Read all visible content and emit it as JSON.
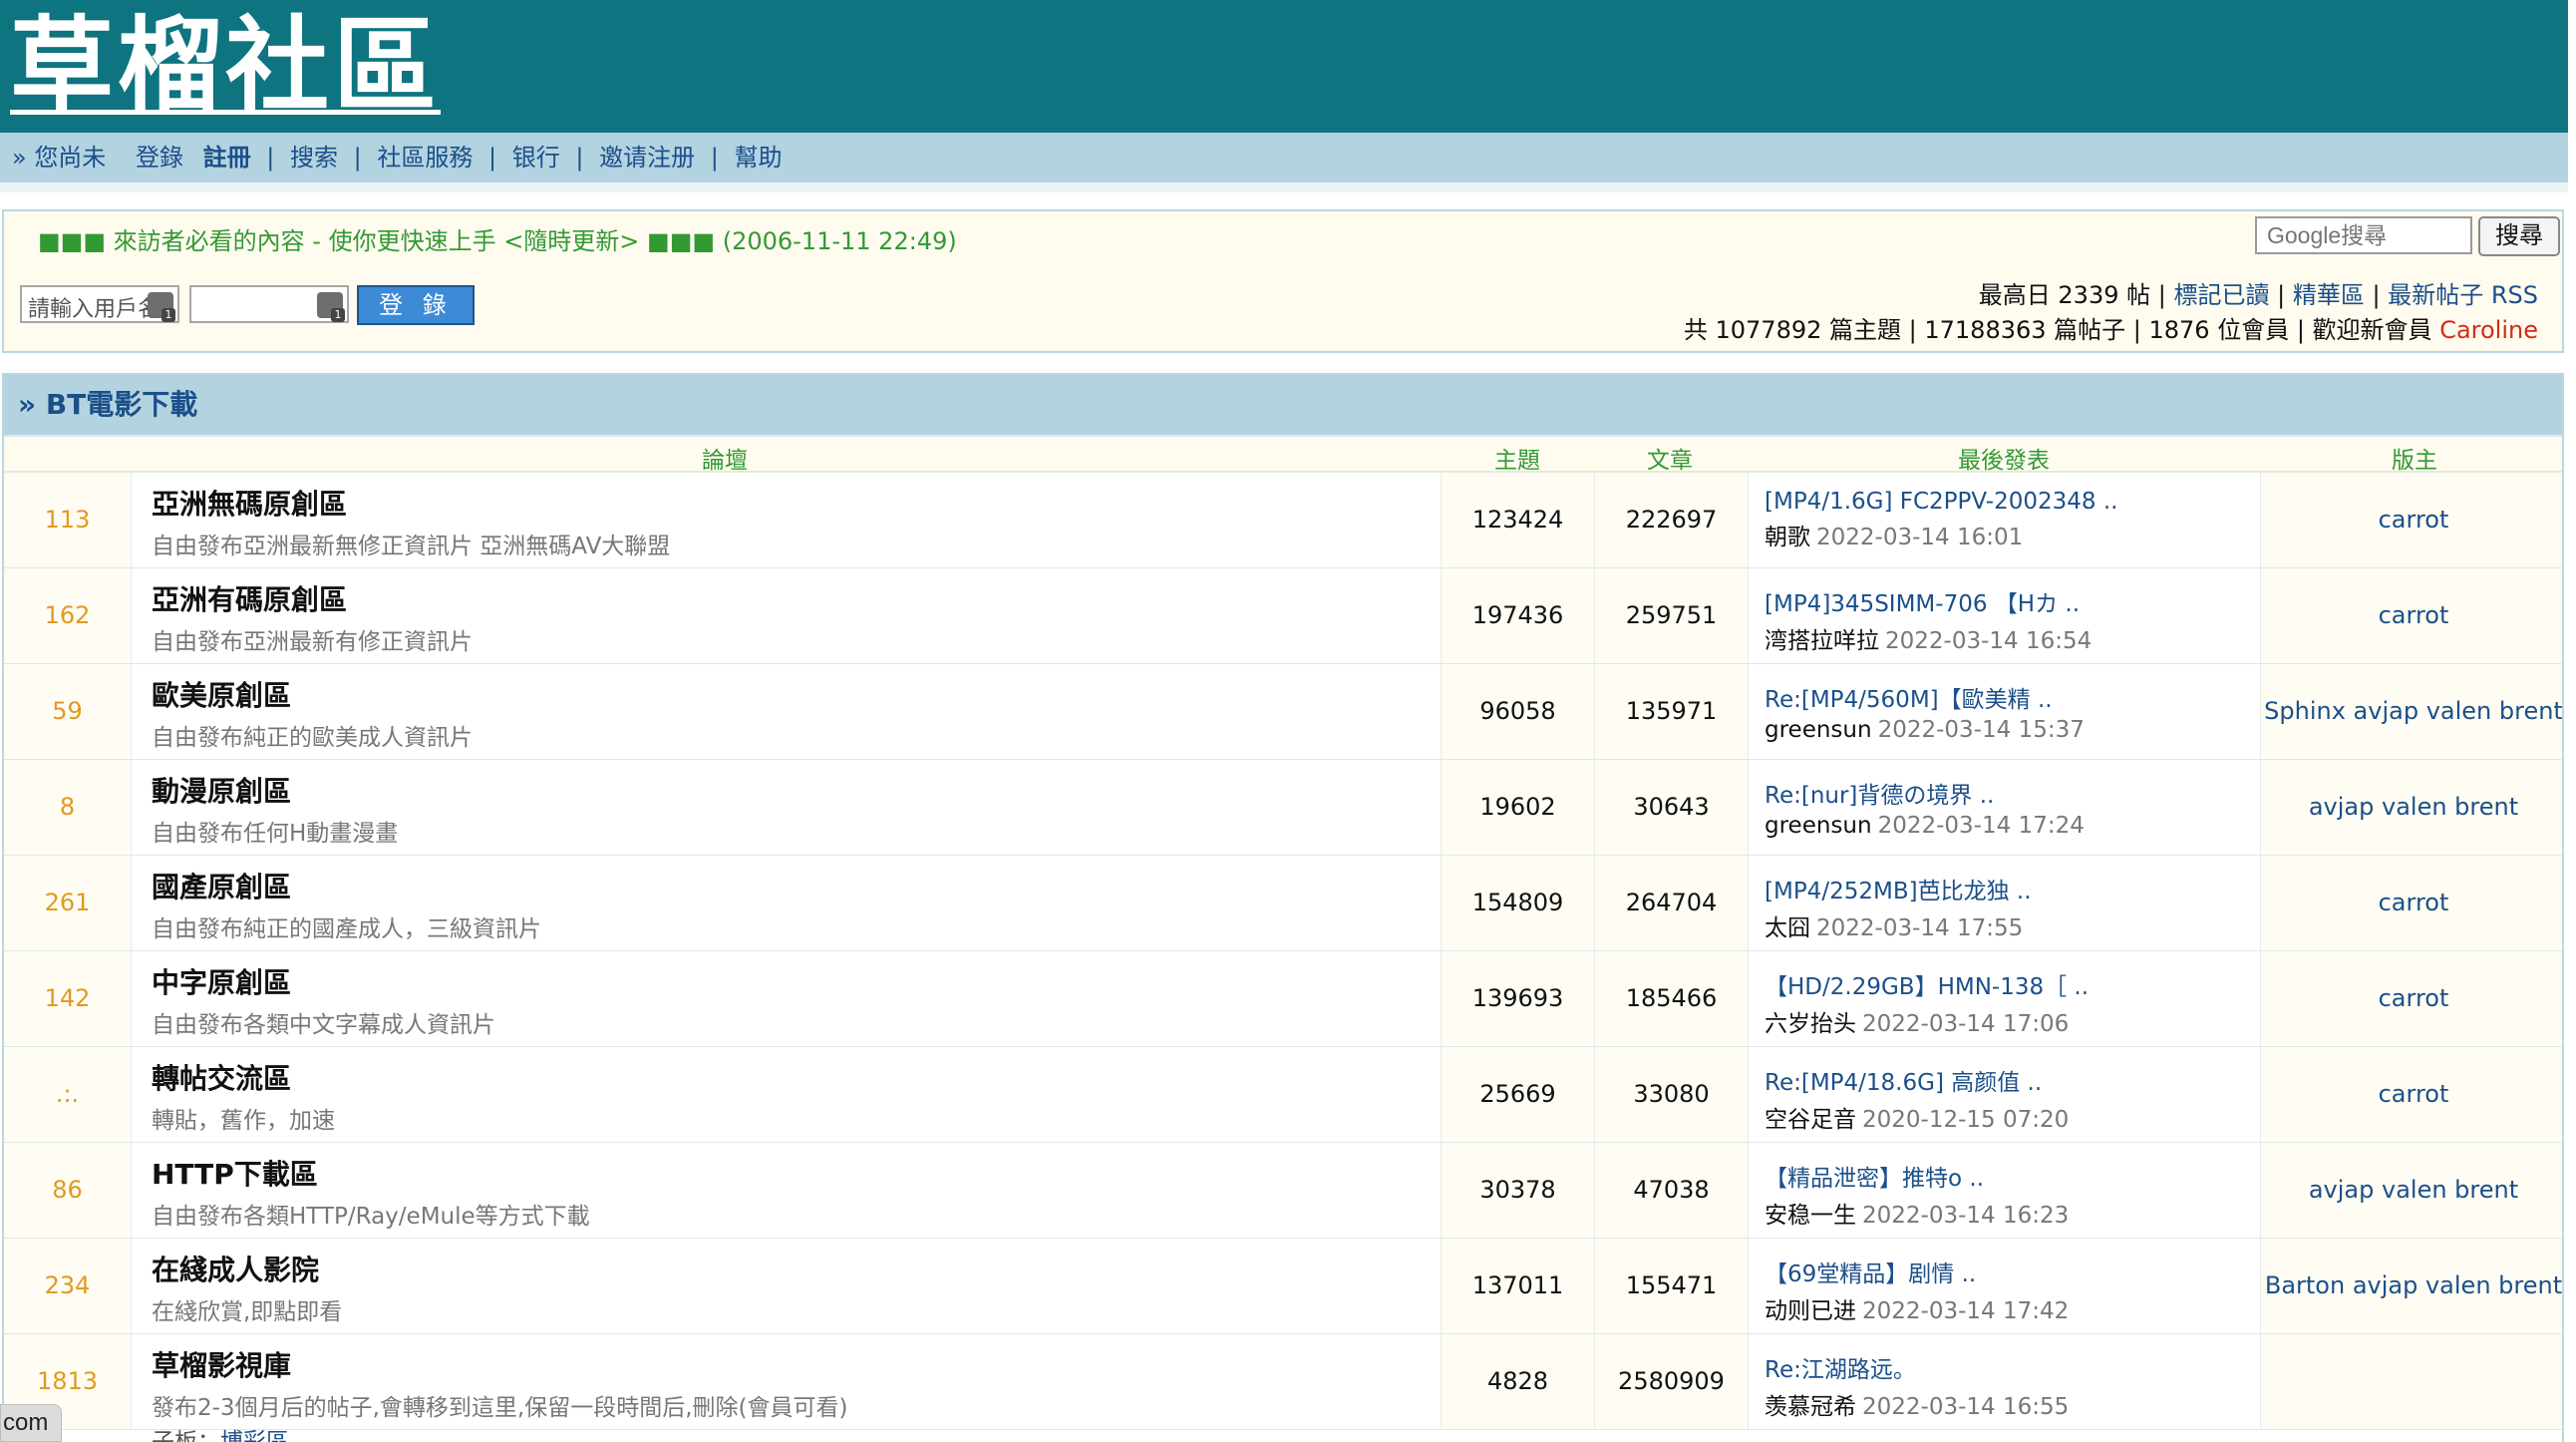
{
  "site": {
    "logo": "草榴社區"
  },
  "nav": {
    "prefix": "» 您尚未",
    "login": "登錄",
    "register": "註冊",
    "search": "搜索",
    "services": "社區服務",
    "bank": "银行",
    "invite": "邀请注册",
    "help": "幫助"
  },
  "notice": {
    "text": "■■■ 來訪者必看的內容 - 使你更快速上手 <隨時更新> ■■■ (2006-11-11 22:49)"
  },
  "google": {
    "placeholder": "Google搜尋",
    "button": "搜尋"
  },
  "login": {
    "user_placeholder": "請輸入用戶名",
    "button": "登 錄"
  },
  "stats": {
    "max_day": "最高日 2339 帖",
    "mark_read": "標記已讀",
    "essence": "精華區",
    "latest": "最新帖子",
    "rss": "RSS",
    "summary": "共 1077892 篇主題 | 17188363 篇帖子 | 1876 位會員 | 歡迎新會員",
    "new_member": "Caroline"
  },
  "category": {
    "title": "» BT電影下載"
  },
  "columns": {
    "forum": "論壇",
    "topics": "主題",
    "posts": "文章",
    "last_post": "最後發表",
    "moderator": "版主"
  },
  "forums": [
    {
      "today": "113",
      "name": "亞洲無碼原創區",
      "desc": "自由發布亞洲最新無修正資訊片 亞洲無碼AV大聯盟",
      "topics": "123424",
      "posts": "222697",
      "last_title": "[MP4/1.6G] FC2PPV-2002348 ..",
      "last_user": "朝歌",
      "last_time": "2022-03-14 16:01",
      "mods": "carrot"
    },
    {
      "today": "162",
      "name": "亞洲有碼原創區",
      "desc": "自由發布亞洲最新有修正資訊片",
      "topics": "197436",
      "posts": "259751",
      "last_title": "[MP4]345SIMM-706 【Hカ ..",
      "last_user": "湾搭拉咩拉",
      "last_time": "2022-03-14 16:54",
      "mods": "carrot"
    },
    {
      "today": "59",
      "name": "歐美原創區",
      "desc": "自由發布純正的歐美成人資訊片",
      "topics": "96058",
      "posts": "135971",
      "last_title": "Re:[MP4/560M]【歐美精 ..",
      "last_user": "greensun",
      "last_time": "2022-03-14 15:37",
      "mods": "Sphinx avjap valen brent"
    },
    {
      "today": "8",
      "name": "動漫原創區",
      "desc": "自由發布任何H動畫漫畫",
      "topics": "19602",
      "posts": "30643",
      "last_title": "Re:[nur]背德の境界 ..",
      "last_user": "greensun",
      "last_time": "2022-03-14 17:24",
      "mods": "avjap valen brent"
    },
    {
      "today": "261",
      "name": "國產原創區",
      "desc": "自由發布純正的國產成人，三級資訊片",
      "topics": "154809",
      "posts": "264704",
      "last_title": "[MP4/252MB]芭比龙独 ..",
      "last_user": "太囧",
      "last_time": "2022-03-14 17:55",
      "mods": "carrot"
    },
    {
      "today": "142",
      "name": "中字原創區",
      "desc": "自由發布各類中文字幕成人資訊片",
      "topics": "139693",
      "posts": "185466",
      "last_title": "【HD/2.29GB】HMN-138［ ..",
      "last_user": "六岁抬头",
      "last_time": "2022-03-14 17:06",
      "mods": "carrot"
    },
    {
      "today": ".:.",
      "name": "轉帖交流區",
      "desc": "轉貼，舊作，加速",
      "topics": "25669",
      "posts": "33080",
      "last_title": "Re:[MP4/18.6G] 高颜值 ..",
      "last_user": "空谷足音",
      "last_time": "2020-12-15 07:20",
      "mods": "carrot"
    },
    {
      "today": "86",
      "name": "HTTP下載區",
      "desc": "自由發布各類HTTP/Ray/eMule等方式下載",
      "topics": "30378",
      "posts": "47038",
      "last_title": "【精品泄密】推特o ..",
      "last_user": "安稳一生",
      "last_time": "2022-03-14 16:23",
      "mods": "avjap valen brent"
    },
    {
      "today": "234",
      "name": "在綫成人影院",
      "desc": "在綫欣賞,即點即看",
      "topics": "137011",
      "posts": "155471",
      "last_title": "【69堂精品】剧情 ..",
      "last_user": "动则已进",
      "last_time": "2022-03-14 17:42",
      "mods": "Barton avjap valen brent"
    },
    {
      "today": "1813",
      "name": "草榴影視庫",
      "desc": "發布2-3個月后的帖子,會轉移到這里,保留一段時間后,刪除(會員可看)",
      "sub_label": "子板：",
      "sub_link": "博彩區",
      "topics": "4828",
      "posts": "2580909",
      "last_title": "Re:江湖路远。",
      "last_user": "羡慕冠希",
      "last_time": "2022-03-14 16:55",
      "mods": ""
    }
  ],
  "overlay": {
    "text": "com"
  }
}
